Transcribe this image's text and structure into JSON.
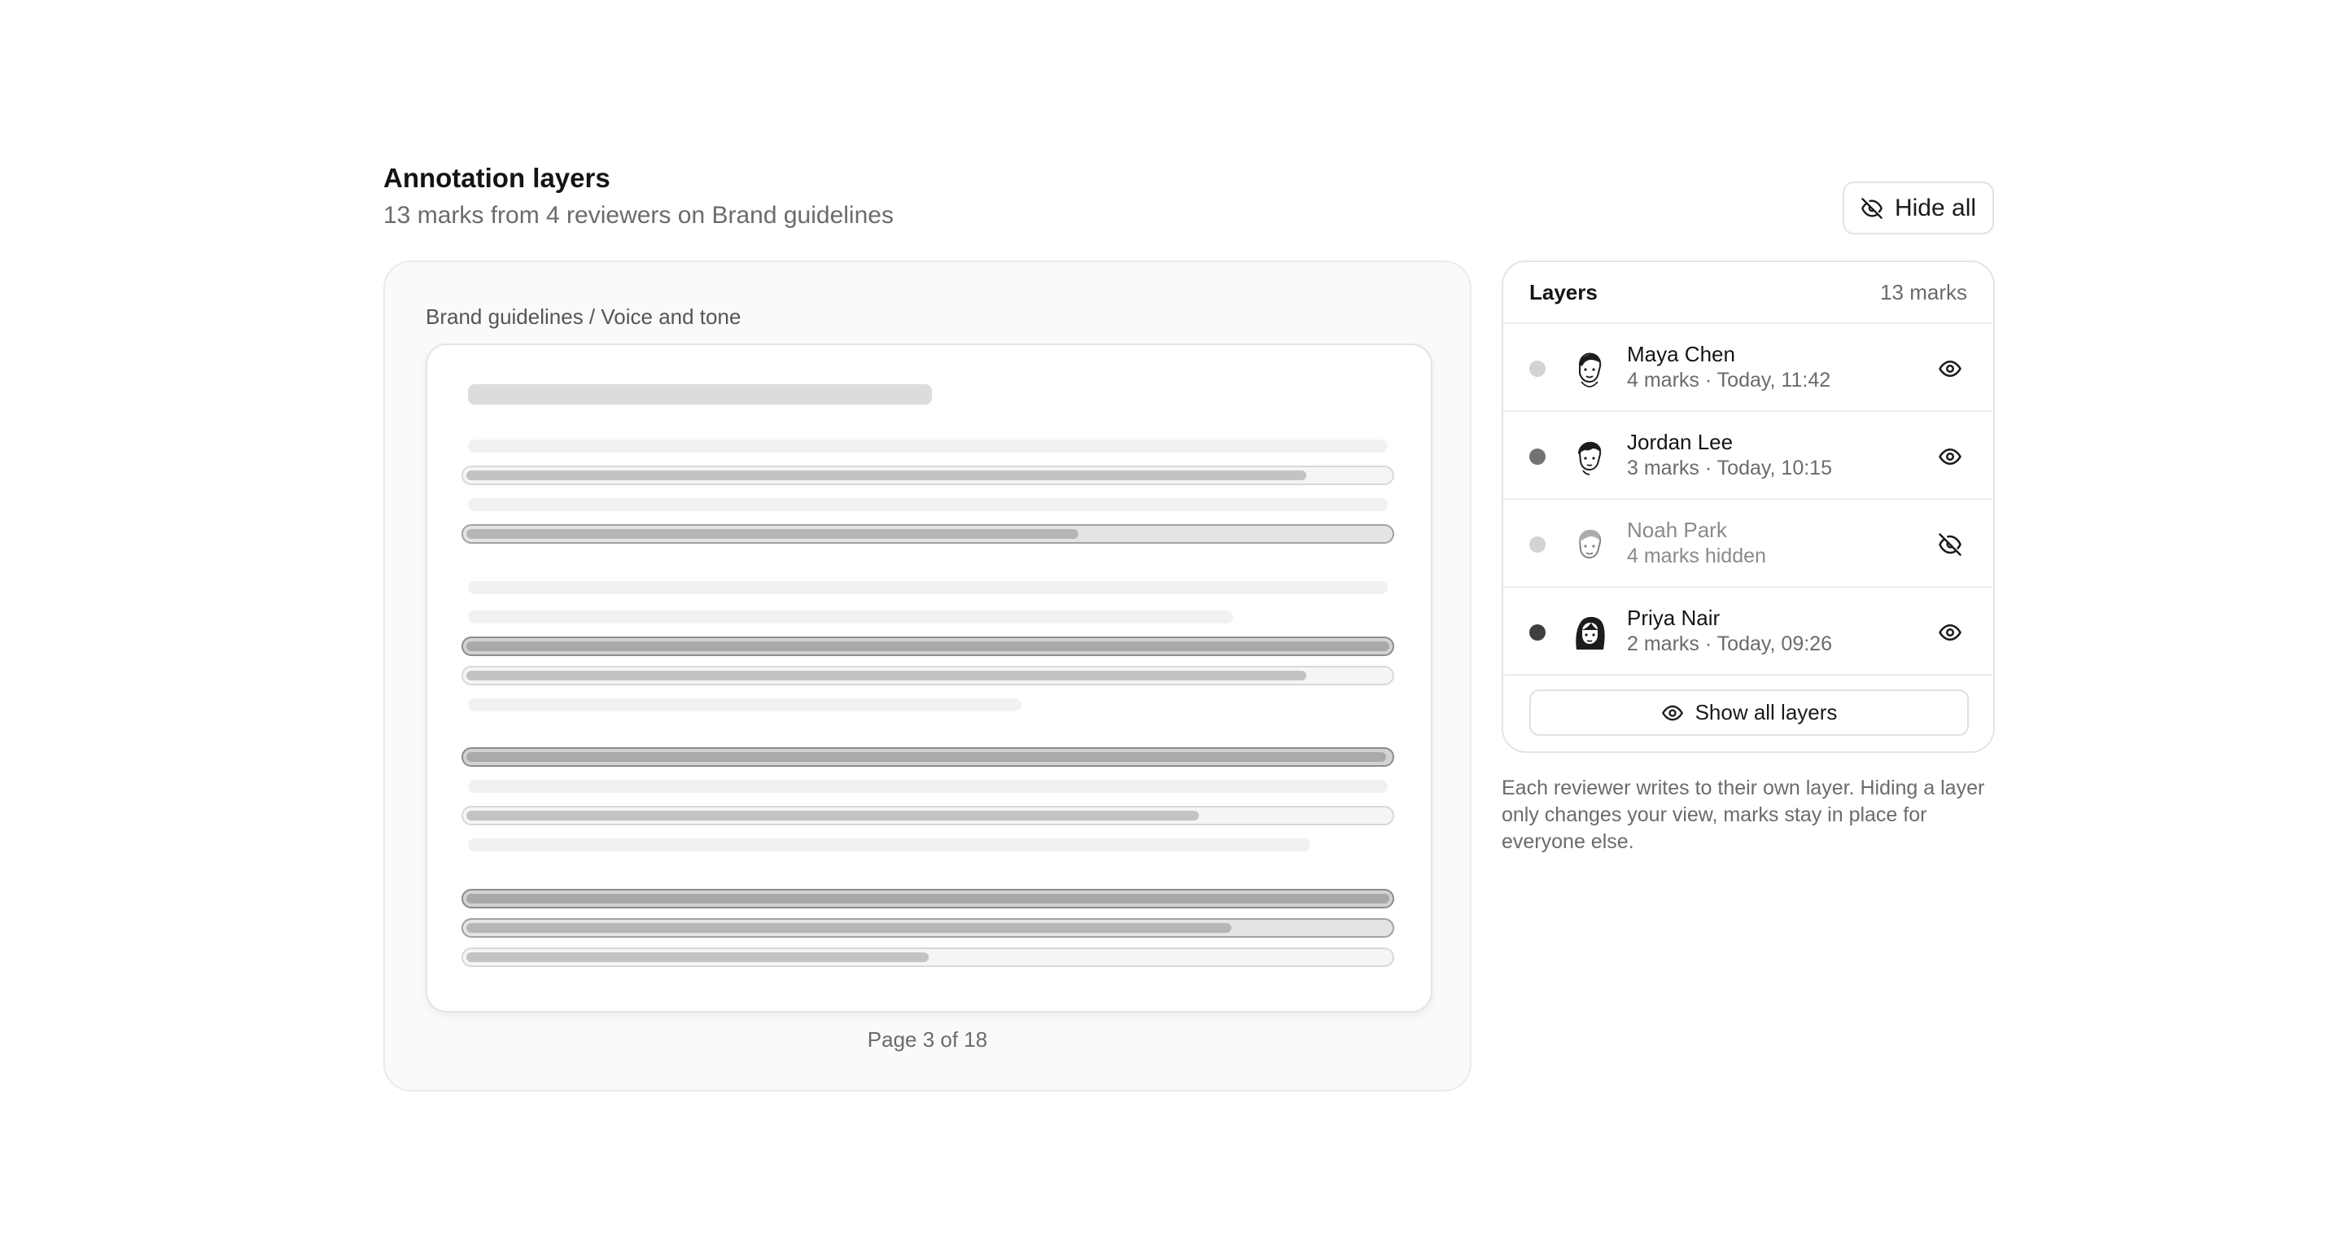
{
  "header": {
    "title": "Annotation layers",
    "subtitle": "13 marks from 4 reviewers on Brand guidelines",
    "hide_all_label": "Hide all"
  },
  "viewer": {
    "breadcrumb": "Brand guidelines / Voice and tone",
    "page_label": "Page 3 of 18"
  },
  "layers": {
    "title": "Layers",
    "count": "13 marks",
    "items": [
      {
        "name": "Maya Chen",
        "meta": "4 marks · Today, 11:42",
        "visible": true,
        "dot_color": "#d3d3d3",
        "icon": "eye-icon"
      },
      {
        "name": "Jordan Lee",
        "meta": "3 marks · Today, 10:15",
        "visible": true,
        "dot_color": "#737373",
        "icon": "eye-icon"
      },
      {
        "name": "Noah Park",
        "meta": "4 marks hidden",
        "visible": false,
        "dot_color": "#d3d3d3",
        "icon": "eye-off-icon"
      },
      {
        "name": "Priya Nair",
        "meta": "2 marks · Today, 09:26",
        "visible": true,
        "dot_color": "#3f3f3f",
        "icon": "eye-icon"
      }
    ],
    "show_all_label": "Show all layers"
  },
  "help_text": "Each reviewer writes to their own layer. Hiding a layer only changes your view, marks stay in place for everyone else."
}
